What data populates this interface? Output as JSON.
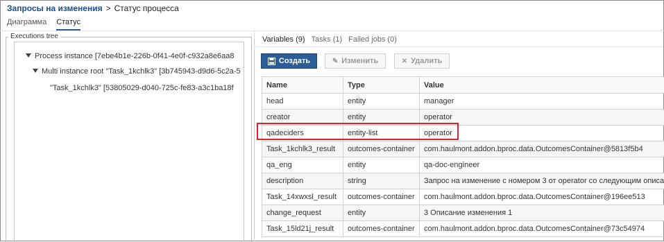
{
  "breadcrumb": {
    "parent": "Запросы на изменения",
    "separator": ">",
    "current": "Статус процесса"
  },
  "view_tabs": [
    {
      "label": "Диаграмма",
      "active": false
    },
    {
      "label": "Статус",
      "active": true
    }
  ],
  "executions_tree": {
    "legend": "Executions tree",
    "nodes": [
      {
        "label": "Process instance [7ebe4b1e-226b-0f41-4e0f-c932a8e6aa8"
      },
      {
        "label": "Multi instance root \"Task_1kchlk3\" [3b745943-d9d6-5c2a-5"
      },
      {
        "label": "\"Task_1kchlk3\" [53805029-d040-725c-fe83-a3c1ba18f"
      }
    ]
  },
  "detail_tabs": [
    {
      "label": "Variables (9)",
      "active": true
    },
    {
      "label": "Tasks (1)",
      "active": false
    },
    {
      "label": "Failed jobs (0)",
      "active": false
    }
  ],
  "toolbar": {
    "create": {
      "label": "Создать",
      "icon": "create-icon"
    },
    "edit": {
      "label": "Изменить",
      "icon": "pencil-icon"
    },
    "delete": {
      "label": "Удалить",
      "icon": "close-icon"
    }
  },
  "table": {
    "columns": [
      "Name",
      "Type",
      "Value"
    ],
    "rows": [
      [
        "head",
        "entity",
        "manager"
      ],
      [
        "creator",
        "entity",
        "operator"
      ],
      [
        "qadeciders",
        "entity-list",
        "operator"
      ],
      [
        "Task_1kchlk3_result",
        "outcomes-container",
        "com.haulmont.addon.bproc.data.OutcomesContainer@5813f5b4"
      ],
      [
        "qa_eng",
        "entity",
        "qa-doc-engineer"
      ],
      [
        "description",
        "string",
        "Запрос на изменение с номером 3 от operator со следующим описан"
      ],
      [
        "Task_14xwxsl_result",
        "outcomes-container",
        "com.haulmont.addon.bproc.data.OutcomesContainer@196ee513"
      ],
      [
        "change_request",
        "entity",
        "3 Описание изменения 1"
      ],
      [
        "Task_15ld21j_result",
        "outcomes-container",
        "com.haulmont.addon.bproc.data.OutcomesContainer@73c54974"
      ]
    ],
    "highlighted_row_index": 2,
    "highlight_color": "#e0202a"
  },
  "colors": {
    "primary_button": "#2c5d96",
    "link": "#1b4d8a"
  }
}
